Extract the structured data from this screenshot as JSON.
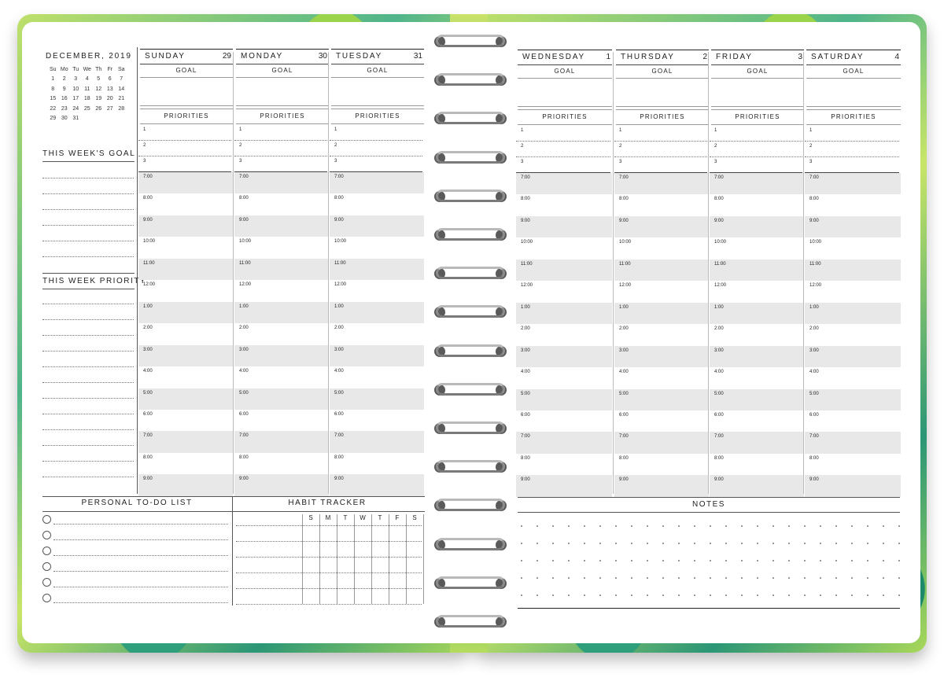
{
  "mini_calendar": {
    "title": "DECEMBER, 2019",
    "weekdays": [
      "Su",
      "Mo",
      "Tu",
      "We",
      "Th",
      "Fr",
      "Sa"
    ],
    "weeks": [
      [
        "",
        "",
        "",
        "",
        "",
        "",
        ""
      ],
      [
        "1",
        "2",
        "3",
        "4",
        "5",
        "6",
        "7"
      ],
      [
        "8",
        "9",
        "10",
        "11",
        "12",
        "13",
        "14"
      ],
      [
        "15",
        "16",
        "17",
        "18",
        "19",
        "20",
        "21"
      ],
      [
        "22",
        "23",
        "24",
        "25",
        "26",
        "27",
        "28"
      ],
      [
        "29",
        "30",
        "31",
        "",
        "",
        "",
        ""
      ]
    ]
  },
  "sidebar": {
    "weeks_goal": "THIS WEEK'S GOAL",
    "week_priority": "THIS WEEK PRIORITY"
  },
  "days": [
    {
      "name": "SUNDAY",
      "num": "29"
    },
    {
      "name": "MONDAY",
      "num": "30"
    },
    {
      "name": "TUESDAY",
      "num": "31"
    },
    {
      "name": "WEDNESDAY",
      "num": "1"
    },
    {
      "name": "THURSDAY",
      "num": "2"
    },
    {
      "name": "FRIDAY",
      "num": "3"
    },
    {
      "name": "SATURDAY",
      "num": "4"
    }
  ],
  "labels": {
    "goal": "GOAL",
    "priorities": "PRIORITIES",
    "prio_nums": [
      "1",
      "2",
      "3"
    ],
    "todo": "PERSONAL TO-DO LIST",
    "habit": "HABIT TRACKER",
    "notes": "NOTES",
    "habit_days": [
      "S",
      "M",
      "T",
      "W",
      "T",
      "F",
      "S"
    ]
  },
  "hours": [
    "7:00",
    "8:00",
    "9:00",
    "10:00",
    "11:00",
    "12:00",
    "1:00",
    "2:00",
    "3:00",
    "4:00",
    "5:00",
    "6:00",
    "7:00",
    "8:00",
    "9:00"
  ]
}
